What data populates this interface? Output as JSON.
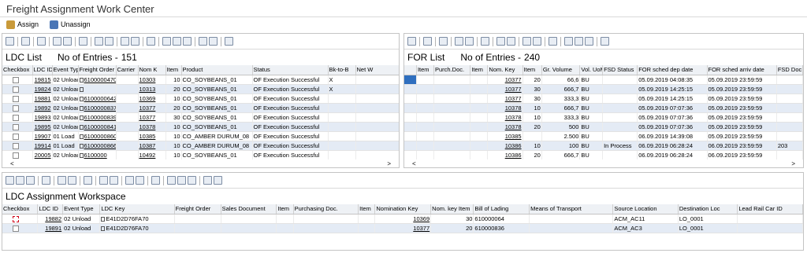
{
  "app": {
    "title": "Freight Assignment Work Center"
  },
  "toolbar": {
    "assign_label": "Assign",
    "unassign_label": "Unassign"
  },
  "ldc_list": {
    "title": "LDC List",
    "count_label": "No of Entries -",
    "count": "151",
    "columns": [
      "Checkbox",
      "LDC ID",
      "Event Type",
      "Freight Order",
      "Carrier",
      "Nom K",
      "Item",
      "Product",
      "Status",
      "Bk-to-B",
      "Net W"
    ],
    "rows": [
      {
        "ldc": "19815",
        "event": "02 Unloac",
        "fo": "6100000470",
        "nom": "10303",
        "item": "10",
        "product": "CO_SOYBEANS_01",
        "status": "OF Execution Successful",
        "bk": "X"
      },
      {
        "ldc": "19824",
        "event": "02 Unloac",
        "fo": "",
        "nom": "10313",
        "item": "20",
        "product": "CO_SOYBEANS_01",
        "status": "OF Execution Successful",
        "bk": "X"
      },
      {
        "ldc": "19881",
        "event": "02 Unloac",
        "fo": "6100000642",
        "nom": "10369",
        "item": "10",
        "product": "CO_SOYBEANS_01",
        "status": "OF Execution Successful",
        "bk": ""
      },
      {
        "ldc": "19892",
        "event": "02 Unloac",
        "fo": "6100000837",
        "nom": "10377",
        "item": "20",
        "product": "CO_SOYBEANS_01",
        "status": "OF Execution Successful",
        "bk": ""
      },
      {
        "ldc": "19893",
        "event": "02 Unloac",
        "fo": "6100000839",
        "nom": "10377",
        "item": "30",
        "product": "CO_SOYBEANS_01",
        "status": "OF Execution Successful",
        "bk": ""
      },
      {
        "ldc": "19895",
        "event": "02 Unloac",
        "fo": "6100000841",
        "nom": "10378",
        "item": "10",
        "product": "CO_SOYBEANS_01",
        "status": "OF Execution Successful",
        "bk": ""
      },
      {
        "ldc": "19907",
        "event": "01 Load",
        "fo": "6100000860",
        "nom": "10385",
        "item": "10",
        "product": "CO_AMBER DURUM_08",
        "status": "OF Execution Successful",
        "bk": ""
      },
      {
        "ldc": "19914",
        "event": "01 Load",
        "fo": "6100000866",
        "nom": "10387",
        "item": "10",
        "product": "CO_AMBER DURUM_08",
        "status": "OF Execution Successful",
        "bk": ""
      },
      {
        "ldc": "20005",
        "event": "02 Unloac",
        "fo": "6100000",
        "nom": "10492",
        "item": "10",
        "product": "CO_SOYBEANS_01",
        "status": "OF Execution Successful",
        "bk": ""
      }
    ]
  },
  "for_list": {
    "title": "FOR List",
    "count_label": "No of Entries -",
    "count": "240",
    "columns": [
      "Item",
      "Purch.Doc.",
      "Item",
      "Nom. Key",
      "Item",
      "Gr. Volume",
      "Vol. UoM",
      "FSD Status",
      "FOR sched dep date",
      "FOR sched arriv date",
      "FSD Doc"
    ],
    "rows": [
      {
        "nom": "10377",
        "item": "20",
        "vol": "66,6",
        "uom": "BU",
        "fsd": "",
        "dep": "05.09.2019 04:08:35",
        "arr": "05.09.2019 23:59:59",
        "doc": ""
      },
      {
        "nom": "10377",
        "item": "30",
        "vol": "666,7",
        "uom": "BU",
        "fsd": "",
        "dep": "05.09.2019 14:25:15",
        "arr": "05.09.2019 23:59:59",
        "doc": ""
      },
      {
        "nom": "10377",
        "item": "30",
        "vol": "333,3",
        "uom": "BU",
        "fsd": "",
        "dep": "05.09.2019 14:25:15",
        "arr": "05.09.2019 23:59:59",
        "doc": ""
      },
      {
        "nom": "10378",
        "item": "10",
        "vol": "666,7",
        "uom": "BU",
        "fsd": "",
        "dep": "05.09.2019 07:07:36",
        "arr": "05.09.2019 23:59:59",
        "doc": ""
      },
      {
        "nom": "10378",
        "item": "10",
        "vol": "333,3",
        "uom": "BU",
        "fsd": "",
        "dep": "05.09.2019 07:07:36",
        "arr": "05.09.2019 23:59:59",
        "doc": ""
      },
      {
        "nom": "10378",
        "item": "20",
        "vol": "500",
        "uom": "BU",
        "fsd": "",
        "dep": "05.09.2019 07:07:36",
        "arr": "05.09.2019 23:59:59",
        "doc": ""
      },
      {
        "nom": "10385",
        "item": "",
        "vol": "2.500",
        "uom": "BU",
        "fsd": "",
        "dep": "06.09.2019 14:39:08",
        "arr": "05.09.2019 23:59:59",
        "doc": ""
      },
      {
        "nom": "10386",
        "item": "10",
        "vol": "100",
        "uom": "BU",
        "fsd": "In Process",
        "dep": "06.09.2019 06:28:24",
        "arr": "06.09.2019 23:59:59",
        "doc": "203"
      },
      {
        "nom": "10386",
        "item": "20",
        "vol": "666,7",
        "uom": "BU",
        "fsd": "",
        "dep": "06.09.2019 06:28:24",
        "arr": "06.09.2019 23:59:59",
        "doc": ""
      }
    ]
  },
  "workspace": {
    "title": "LDC Assignment Workspace",
    "columns": [
      "Checkbox",
      "LDC ID",
      "Event Type",
      "LDC Key",
      "Freight Order",
      "Sales Document",
      "Item",
      "Purchasing Doc.",
      "Item",
      "Nomination Key",
      "Nom. key Item",
      "Bill of Lading",
      "Means of Transport",
      "Source Location",
      "Destination Loc",
      "Lead Rail Car ID"
    ],
    "rows": [
      {
        "ldc": "19882",
        "event": "02 Unload",
        "key": "E41D2D76FA70",
        "nom": "10369",
        "item": "30",
        "bol": "610000064",
        "src": "ACM_AC11",
        "dst": "LO_0001"
      },
      {
        "ldc": "19891",
        "event": "02 Unload",
        "key": "E41D2D76FA70",
        "nom": "10377",
        "item": "20",
        "bol": "610000836",
        "src": "ACM_AC3",
        "dst": "LO_0001"
      }
    ]
  },
  "scroll": {
    "left_arrow": "<",
    "right_arrow": ">"
  }
}
